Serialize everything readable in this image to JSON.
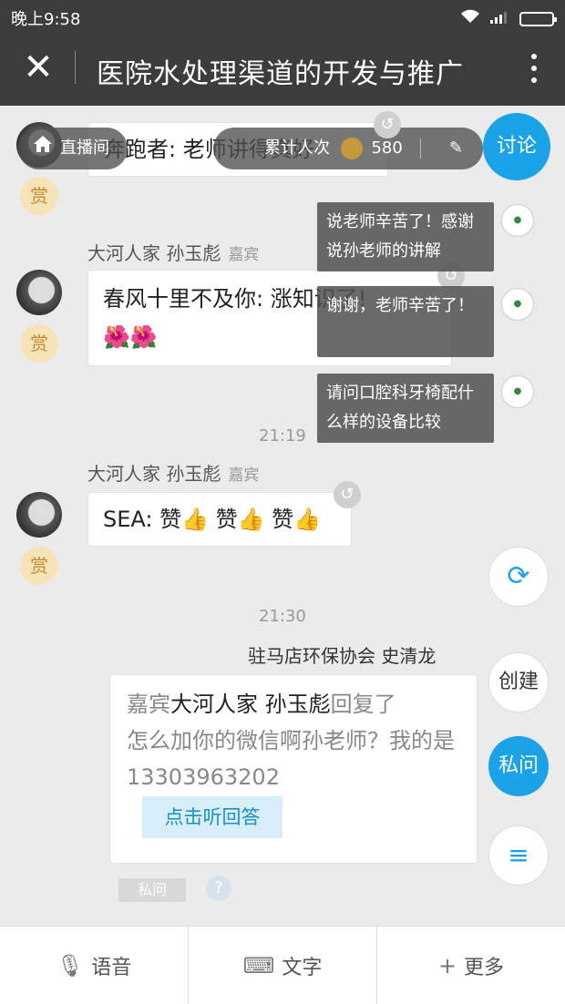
{
  "status": {
    "time": "晚上9:58"
  },
  "header": {
    "title": "医院水处理渠道的开发与推广"
  },
  "overlay": {
    "live_label": "直播间",
    "viewers_label": "累计人次",
    "viewers_count": "580",
    "discuss_label": "讨论"
  },
  "messages": [
    {
      "text": "奔跑者: 老师讲得真好",
      "reward": "赏"
    },
    {
      "name": "大河人家 孙玉彪",
      "role": "嘉宾",
      "text": "春风十里不及你: 涨知识了!",
      "emoji": "🌺🌺",
      "reward": "赏"
    },
    {
      "time": "21:19"
    },
    {
      "name": "大河人家 孙玉彪",
      "role": "嘉宾",
      "text": "SEA: 赞👍 赞👍 赞👍",
      "reward": "赏"
    },
    {
      "time": "21:30"
    },
    {
      "sender": "驻马店环保协会 史清龙"
    }
  ],
  "notifications": [
    {
      "text": "说老师辛苦了！感谢说孙老师的讲解"
    },
    {
      "text": "谢谢，老师辛苦了！"
    },
    {
      "text": "请问口腔科牙椅配什么样的设备比较"
    }
  ],
  "reply": {
    "prefix": "嘉宾",
    "who": "大河人家 孙玉彪",
    "suffix": "回复了",
    "body": "怎么加你的微信啊孙老师？我的是13303963202",
    "listen_label": "点击听回答",
    "private_tag": "私问",
    "help": "?"
  },
  "fabs": {
    "create_label": "创建",
    "private_label": "私问"
  },
  "toolbar": {
    "voice_label": "语音",
    "text_label": "文字",
    "more_label": "更多"
  }
}
